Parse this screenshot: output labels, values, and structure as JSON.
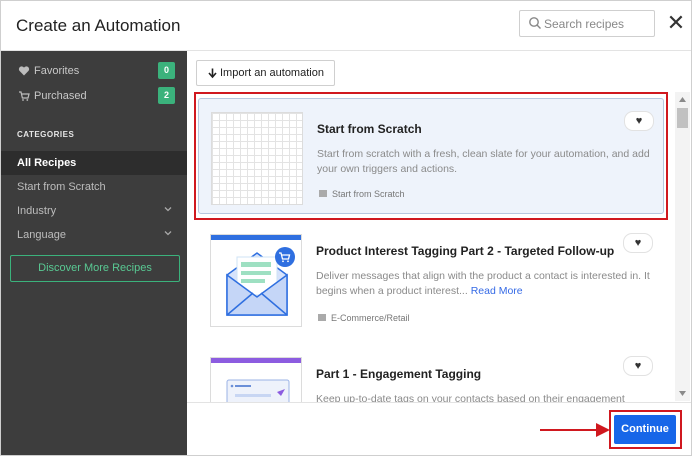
{
  "header": {
    "title": "Create an Automation",
    "search_placeholder": "Search recipes",
    "close_glyph": "✕"
  },
  "sidebar": {
    "top_items": [
      {
        "label": "Favorites",
        "icon": "heart-icon",
        "count": "0"
      },
      {
        "label": "Purchased",
        "icon": "cart-icon",
        "count": "2"
      }
    ],
    "categories_title": "CATEGORIES",
    "categories": [
      {
        "label": "All Recipes",
        "active": true,
        "expandable": false
      },
      {
        "label": "Start from Scratch",
        "active": false,
        "expandable": false
      },
      {
        "label": "Industry",
        "active": false,
        "expandable": true
      },
      {
        "label": "Language",
        "active": false,
        "expandable": true
      }
    ],
    "discover_label": "Discover More Recipes"
  },
  "main": {
    "import_label": "Import an automation",
    "recipes": [
      {
        "title": "Start from Scratch",
        "description": "Start from scratch with a fresh, clean slate for your automation, and add your own triggers and actions.",
        "read_more": "",
        "category": "Start from Scratch",
        "selected": true
      },
      {
        "title": "Product Interest Tagging Part 2 - Targeted Follow-up",
        "description": "Deliver messages that align with the product a contact is interested in. It begins when a product interest...",
        "read_more": "Read More",
        "category": "E-Commerce/Retail",
        "selected": false
      },
      {
        "title": "Part 1 - Engagement Tagging",
        "description": "Keep up-to-date tags on your contacts based on their engagement",
        "read_more": "",
        "category": "",
        "selected": false
      }
    ]
  },
  "footer": {
    "continue_label": "Continue"
  },
  "colors": {
    "sidebar_bg": "#3d3d3d",
    "accent_green": "#3bb27c",
    "primary_blue": "#1766e8",
    "highlight_red": "#d0181f",
    "selected_card_bg": "#eef3fb"
  }
}
